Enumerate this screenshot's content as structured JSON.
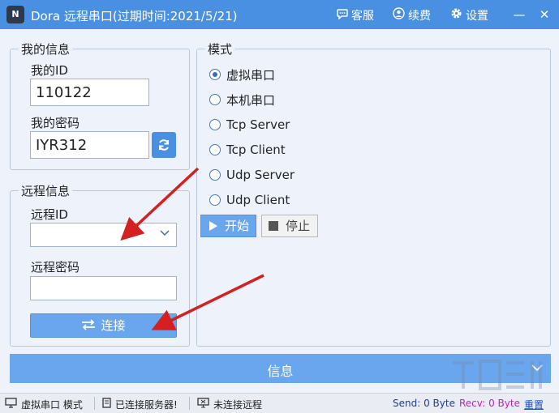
{
  "titlebar": {
    "logo_text": "N",
    "title": "Dora 远程串口(过期时间:2021/5/21)",
    "service_label": "客服",
    "service_icon": "chat-bubble-icon",
    "renew_label": "续费",
    "renew_icon": "user-circle-icon",
    "settings_label": "设置",
    "settings_icon": "gear-icon",
    "minimize_glyph": "—",
    "close_glyph": "✕"
  },
  "my_info": {
    "title": "我的信息",
    "id_label": "我的ID",
    "id_value": "110122",
    "password_label": "我的密码",
    "password_value": "IYR312",
    "refresh_icon": "refresh-icon"
  },
  "remote_info": {
    "title": "远程信息",
    "id_label": "远程ID",
    "id_value": "",
    "password_label": "远程密码",
    "password_value": "",
    "connect_label": "连接",
    "connect_icon": "swap-arrows-icon"
  },
  "mode": {
    "title": "模式",
    "options": [
      {
        "label": "虚拟串口",
        "checked": true
      },
      {
        "label": "本机串口",
        "checked": false
      },
      {
        "label": "Tcp Server",
        "checked": false
      },
      {
        "label": "Tcp Client",
        "checked": false
      },
      {
        "label": "Udp Server",
        "checked": false
      },
      {
        "label": "Udp Client",
        "checked": false
      }
    ],
    "start_label": "开始",
    "stop_label": "停止"
  },
  "info_bar": {
    "label": "信息"
  },
  "statusbar": {
    "mode_text": "虚拟串口 模式",
    "server_text": "已连接服务器!",
    "remote_text": "未连接远程",
    "send_text": "Send: 0 Byte",
    "recv_text": "Recv: 0 Byte",
    "reset_label": "重置",
    "send_color": "#1a3c9c",
    "recv_color": "#c21cc4"
  },
  "colors": {
    "titlebar": "#4a90e2",
    "accent_button": "#6aa6ee",
    "annotation_arrow": "#d42020"
  }
}
